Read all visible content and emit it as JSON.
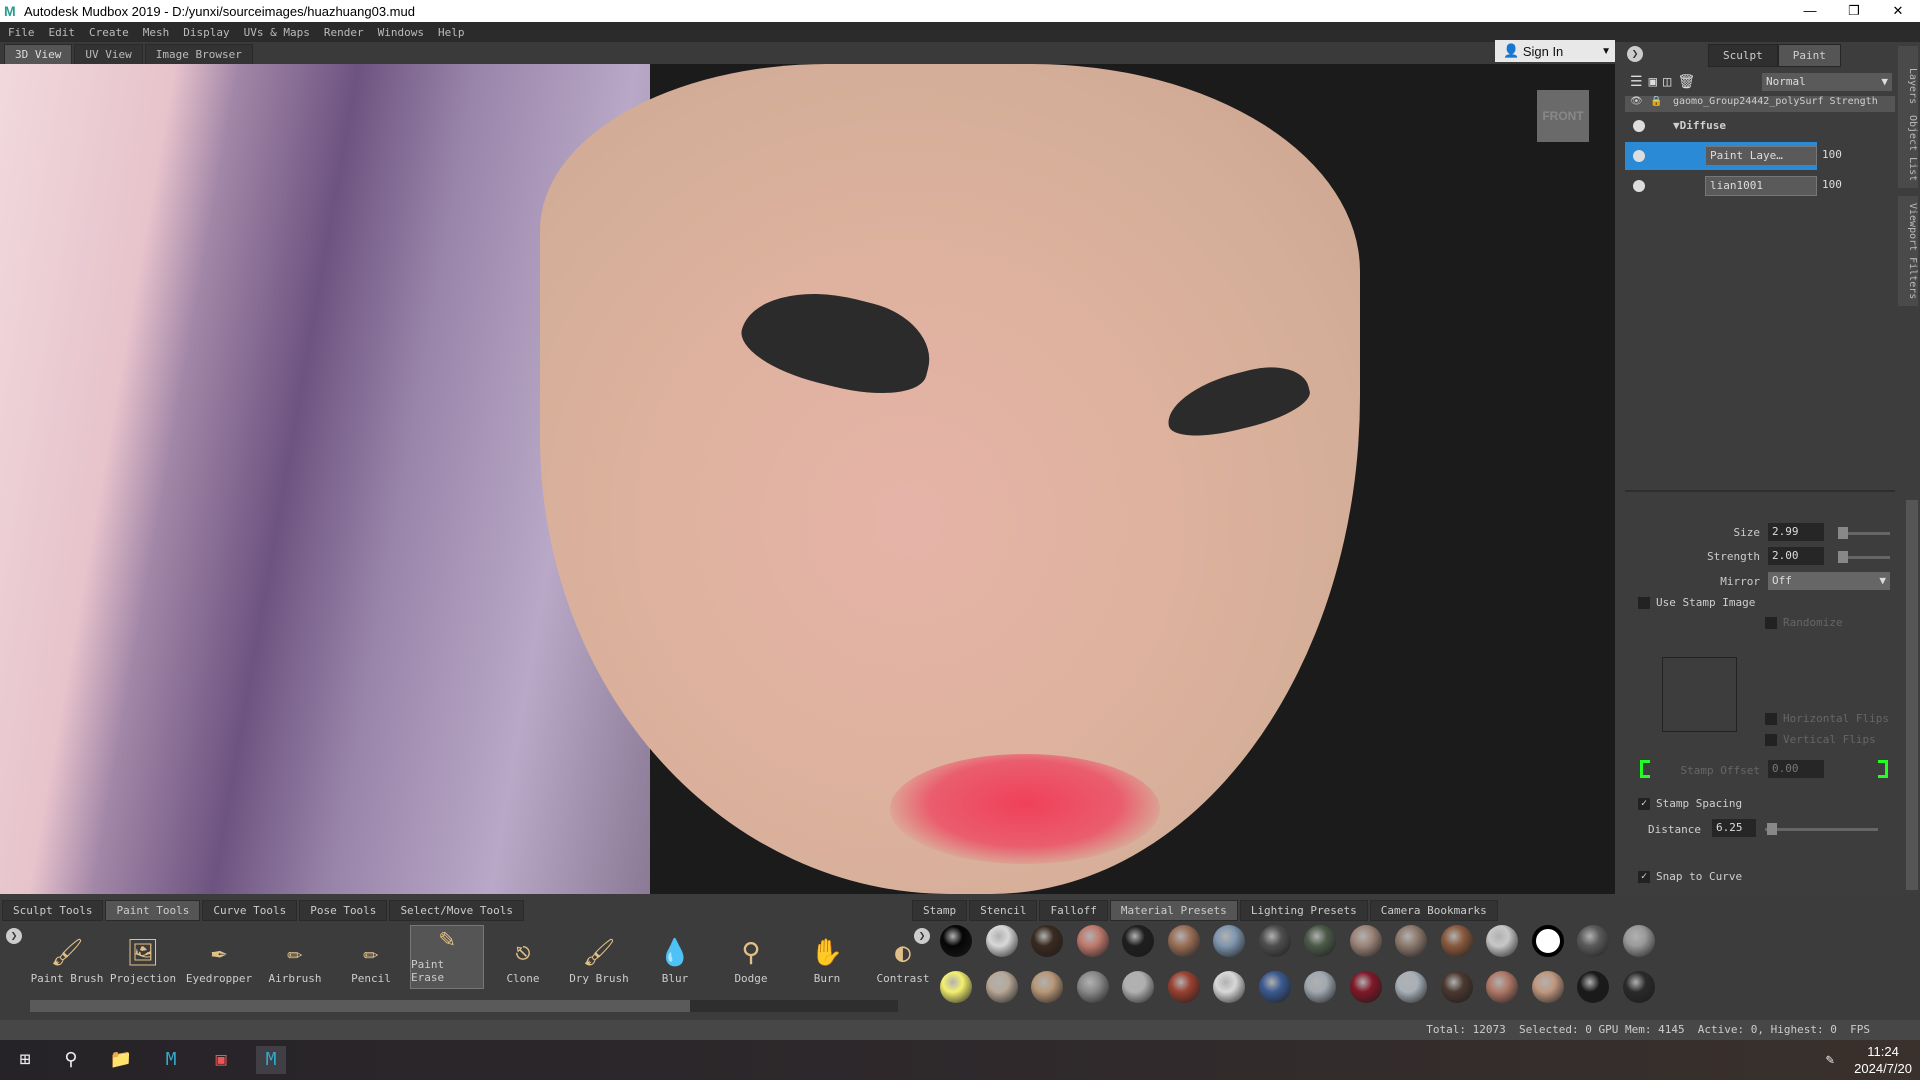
{
  "title": "Autodesk Mudbox 2019 - D:/yunxi/sourceimages/huazhuang03.mud",
  "menu": [
    "File",
    "Edit",
    "Create",
    "Mesh",
    "Display",
    "UVs & Maps",
    "Render",
    "Windows",
    "Help"
  ],
  "view_tabs": [
    "3D View",
    "UV View",
    "Image Browser"
  ],
  "sign_in": "Sign In",
  "viewcube": "FRONT",
  "right_tabs": [
    "Sculpt",
    "Paint"
  ],
  "side_tabs": [
    "Layers",
    "Object List",
    "Viewport Filters"
  ],
  "layers": {
    "blend_mode": "Normal",
    "header_name": "gaomo_Group24442_polySurf",
    "header_col": "Strength",
    "group": "Diffuse",
    "items": [
      {
        "name": "Paint Laye…",
        "value": "100",
        "selected": true
      },
      {
        "name": "lian1001",
        "value": "100",
        "selected": false
      }
    ]
  },
  "props": {
    "size_label": "Size",
    "size": "2.99",
    "strength_label": "Strength",
    "strength": "2.00",
    "mirror_label": "Mirror",
    "mirror": "Off",
    "use_stamp": "Use Stamp Image",
    "randomize": "Randomize",
    "hflips": "Horizontal Flips",
    "vflips": "Vertical Flips",
    "stamp_offset_label": "Stamp Offset",
    "stamp_offset": "0.00",
    "stamp_spacing": "Stamp Spacing",
    "distance_label": "Distance",
    "distance": "6.25",
    "snap": "Snap to Curve"
  },
  "tool_tabs": [
    "Sculpt Tools",
    "Paint Tools",
    "Curve Tools",
    "Pose Tools",
    "Select/Move Tools"
  ],
  "tools": [
    {
      "label": "Paint Brush",
      "icon": "paintbrush-icon"
    },
    {
      "label": "Projection",
      "icon": "projection-icon"
    },
    {
      "label": "Eyedropper",
      "icon": "eyedropper-icon"
    },
    {
      "label": "Airbrush",
      "icon": "airbrush-icon"
    },
    {
      "label": "Pencil",
      "icon": "pencil-icon"
    },
    {
      "label": "Paint Erase",
      "icon": "eraser-icon",
      "active": true
    },
    {
      "label": "Clone",
      "icon": "stamp-icon"
    },
    {
      "label": "Dry Brush",
      "icon": "drybrush-icon"
    },
    {
      "label": "Blur",
      "icon": "drop-icon"
    },
    {
      "label": "Dodge",
      "icon": "dodge-icon"
    },
    {
      "label": "Burn",
      "icon": "hand-icon"
    },
    {
      "label": "Contrast",
      "icon": "contrast-icon"
    }
  ],
  "preset_tabs": [
    "Stamp",
    "Stencil",
    "Falloff",
    "Material Presets",
    "Lighting Presets",
    "Camera Bookmarks"
  ],
  "materials": [
    "#050505",
    "#d8d8d8",
    "#3a2a20",
    "#c07a6e",
    "#1e1e1e",
    "#9a6e56",
    "#7f97b0",
    "#4e4e4e",
    "#4c5a48",
    "#9c8478",
    "#8e7a6e",
    "#8a5a3e",
    "#c8c8c8",
    "#ffffff",
    "#5a5a5a",
    "#9a9a9a",
    "#f4f070",
    "#b8a898",
    "#b89878",
    "#8a8a8a",
    "#b0b0b0",
    "#9a4030",
    "#d8d8d8",
    "#3a5a90",
    "#a0a8b0",
    "#801828",
    "#a8b0b8",
    "#4a3830",
    "#b07868",
    "#c09880",
    "#1a1a1a",
    "#2a2a2a"
  ],
  "status": "Total: 12073  Selected: 0 GPU Mem: 4145  Active: 0, Highest: 0  FPS",
  "clock": {
    "time": "11:24",
    "date": "2024/7/20"
  }
}
